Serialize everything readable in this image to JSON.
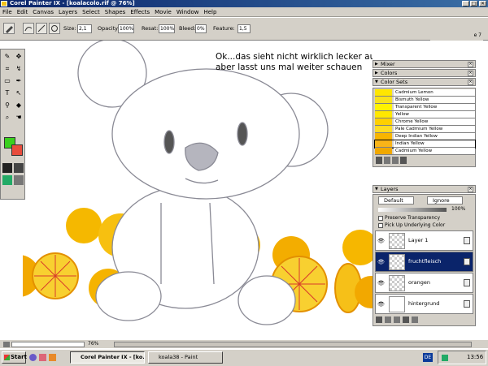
{
  "window": {
    "title": "Corel Painter IX - [koalacolo.rif @ 76%]",
    "controls": {
      "minimize": "_",
      "maximize": "□",
      "close": "✕"
    }
  },
  "menu": [
    "File",
    "Edit",
    "Canvas",
    "Layers",
    "Select",
    "Shapes",
    "Effects",
    "Movie",
    "Window",
    "Help"
  ],
  "property_bar": {
    "size_label": "Size:",
    "size_value": "2,1",
    "opacity_label": "Opacity:",
    "opacity_value": "100%",
    "resat_label": "Resat:",
    "resat_value": "100%",
    "bleed_label": "Bleed:",
    "bleed_value": "0%",
    "feature_label": "Feature:",
    "feature_value": "1,5",
    "doc_tab": "e 7"
  },
  "canvas": {
    "annotation": "Ok...das sieht nicht wirklich lecker aus-aber lasst uns mal weiter schauen"
  },
  "toolbox": {
    "tools": [
      "brush-icon",
      "move-icon",
      "crop-icon",
      "lasso-icon",
      "rect-select-icon",
      "pen-icon",
      "text-icon",
      "select-arrow-icon",
      "dropper-icon",
      "eraser-icon",
      "magnifier-icon",
      "hand-icon"
    ],
    "primary_color": "#3bd01f",
    "secondary_color": "#e84c3d"
  },
  "panels": {
    "mixer": "Mixer",
    "colors": "Colors",
    "color_sets": {
      "title": "Color Sets",
      "items": [
        {
          "name": "Cadmium Lemon",
          "color": "#ffe600"
        },
        {
          "name": "Bismuth Yellow",
          "color": "#f9e21a"
        },
        {
          "name": "Transparent Yellow",
          "color": "#fff200"
        },
        {
          "name": "Yellow",
          "color": "#ffe800"
        },
        {
          "name": "Chrome Yellow",
          "color": "#ffd000"
        },
        {
          "name": "Pale Cadmium Yellow",
          "color": "#ffdd22"
        },
        {
          "name": "Deep Indian Yellow",
          "color": "#f7b500"
        },
        {
          "name": "Indian Yellow",
          "color": "#f9b418"
        },
        {
          "name": "Cadmium Yellow",
          "color": "#f0a800"
        }
      ]
    },
    "layers": {
      "title": "Layers",
      "composite_method": "Default",
      "depth_method": "Ignore",
      "opacity": "100%",
      "preserve_transparency": "Preserve Transparency",
      "pick_up_color": "Pick Up Underlying Color",
      "items": [
        {
          "name": "Layer 1",
          "selected": false
        },
        {
          "name": "fruchtfleisch",
          "selected": true
        },
        {
          "name": "orangen",
          "selected": false
        },
        {
          "name": "hintergrund",
          "selected": false
        }
      ]
    }
  },
  "status": {
    "zoom": "76%"
  },
  "taskbar": {
    "start": "Start",
    "tasks": [
      "Corel Painter IX - [ko...",
      "koala38 - Paint"
    ],
    "language": "DE",
    "clock": "13:56"
  }
}
